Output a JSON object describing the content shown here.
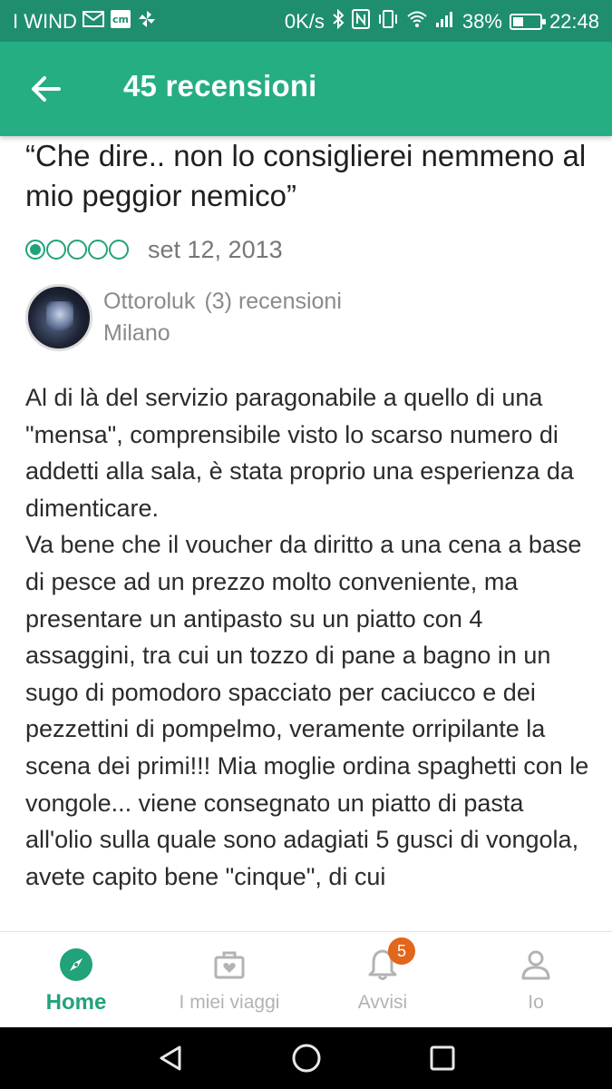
{
  "status_bar": {
    "carrier": "I WIND",
    "speed": "0K/s",
    "battery_percent": "38%",
    "battery_level": 0.38,
    "time": "22:48",
    "icons": [
      "mail-icon",
      "cm-icon",
      "pinwheel-icon",
      "bluetooth-icon",
      "nfc-icon",
      "vibrate-icon",
      "wifi-icon",
      "signal-icon",
      "battery-icon"
    ]
  },
  "app_bar": {
    "back_icon": "arrow-back-icon",
    "title": "45 recensioni"
  },
  "review": {
    "title": "“Che dire.. non lo consiglierei nemmeno al mio peggior nemico”",
    "rating": 1,
    "rating_max": 5,
    "date": "set 12, 2013",
    "author": {
      "name": "Ottoroluk",
      "reviews": "(3) recensioni",
      "location": "Milano"
    },
    "body": "Al di là del servizio paragonabile a quello di una \"mensa\", comprensibile visto lo scarso numero di addetti alla sala, è stata proprio una esperienza da dimenticare.\nVa bene che il voucher da diritto a una cena a base di pesce ad un prezzo molto conveniente, ma presentare un antipasto su un piatto con 4 assaggini, tra cui un tozzo di pane a bagno in un sugo di pomodoro spacciato per caciucco e dei pezzettini di pompelmo, veramente orripilante la scena dei primi!!! Mia moglie ordina spaghetti con le vongole... viene consegnato un piatto di pasta all'olio sulla quale sono adagiati 5 gusci di vongola, avete capito bene \"cinque\", di cui"
  },
  "bottom_nav": {
    "items": [
      {
        "label": "Home",
        "icon": "compass-icon",
        "active": true
      },
      {
        "label": "I miei viaggi",
        "icon": "suitcase-heart-icon",
        "active": false
      },
      {
        "label": "Avvisi",
        "icon": "bell-icon",
        "active": false,
        "badge": "5"
      },
      {
        "label": "Io",
        "icon": "person-icon",
        "active": false
      }
    ]
  },
  "colors": {
    "status_bar": "#1f8e6e",
    "app_bar": "#25ad84",
    "accent": "#21a27b",
    "badge": "#e2661b"
  }
}
